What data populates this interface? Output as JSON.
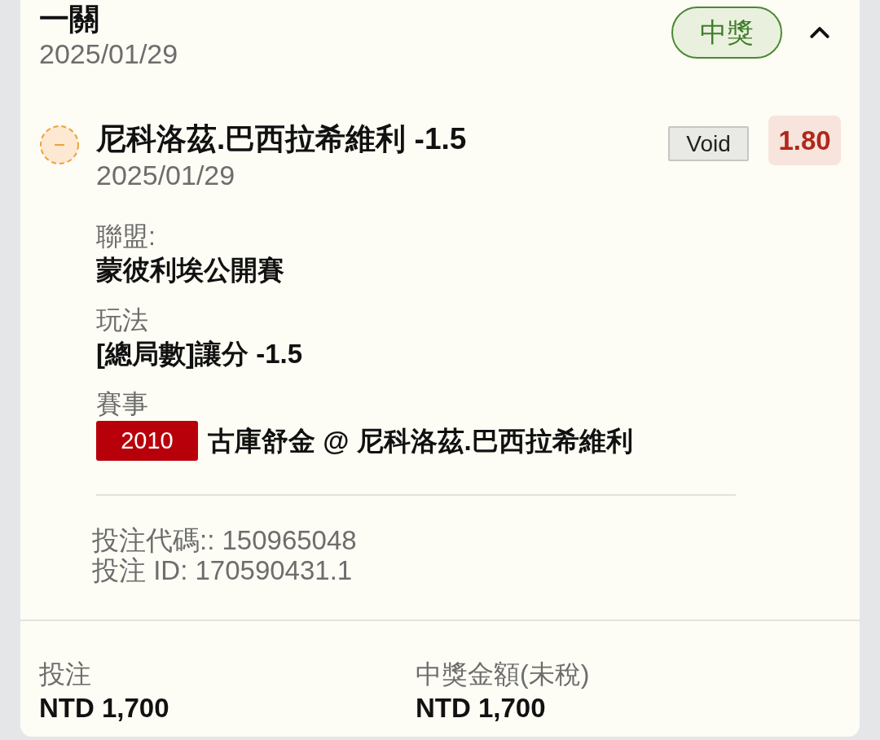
{
  "bet": {
    "type": "一關",
    "date": "2025/01/29",
    "status": {
      "label": "中獎",
      "kind": "won"
    },
    "expanded": true
  },
  "legs": [
    {
      "kind": "void",
      "selection": "尼科洛茲.巴西拉希維利 -1.5",
      "date": "2025/01/29",
      "result": "Void",
      "odds": "1.80",
      "fields": [
        {
          "label": "聯盟:",
          "value": "蒙彼利埃公開賽"
        },
        {
          "label": "玩法",
          "value": "[總局數]讓分 -1.5"
        },
        {
          "label": "賽事",
          "match_code": "2010",
          "value": "古庫舒金 @ 尼科洛茲.巴西拉希維利"
        }
      ],
      "bet_code": "投注代碼:: 150965048",
      "bet_id": "投注 ID: 170590431.1"
    }
  ],
  "summary": [
    {
      "label": "投注",
      "value": "NTD 1,700"
    },
    {
      "label": "中獎金額(未稅)",
      "value": "NTD 1,700"
    }
  ]
}
